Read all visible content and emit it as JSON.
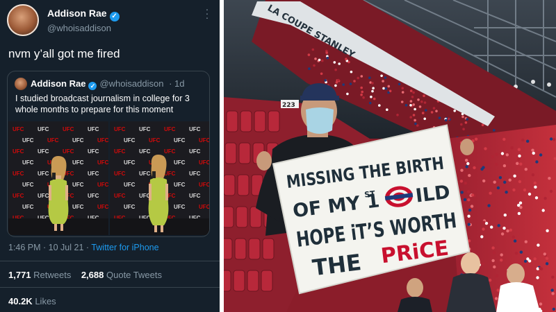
{
  "tweet": {
    "author_name": "Addison Rae",
    "author_handle": "@whoisaddison",
    "verified_glyph": "✓",
    "text": "nvm y’all got me fired",
    "quoted": {
      "author_name": "Addison Rae",
      "author_handle": "@whoisaddison",
      "age": "· 1d",
      "text": "I studied broadcast journalism in college for 3 whole months to prepare for this moment"
    },
    "time": "1:46 PM",
    "date": "· 10 Jul 21 ·",
    "source": "Twitter for iPhone",
    "retweets_count": "1,771",
    "retweets_label": "Retweets",
    "quote_tweets_count": "2,688",
    "quote_tweets_label": "Quote Tweets",
    "likes_count": "40.2K",
    "likes_label": "Likes"
  },
  "backdrop": {
    "logo_text": "UFC",
    "brand_color": "#d20a0a",
    "dress_color": "#b5c944"
  },
  "arena": {
    "banner_text": "LA COUPE STANLEY",
    "section_number": "223",
    "sign": {
      "line1": "MISSING THE BIRTH",
      "line2_a": "OF MY 1",
      "line2_sup": "ST",
      "line2_b": "ILD",
      "line3": "HOPE iT’S WORTH",
      "line4_a": "THE",
      "line4_b": "PRiCE",
      "ink_color": "#1f2f3a",
      "accent_color": "#c8102e"
    },
    "seat_color": "#b8283a"
  }
}
